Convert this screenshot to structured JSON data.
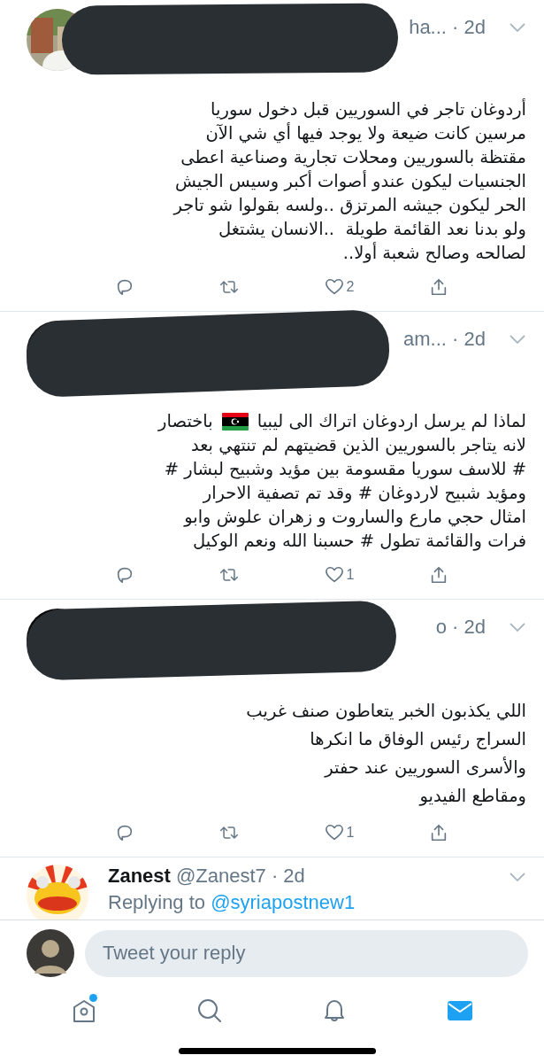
{
  "tweets": [
    {
      "handle": "ha...",
      "time": "· 2d",
      "text": "أردوغان تاجر في السوريين قبل دخول سوريا\nمرسين كانت ضيعة ولا يوجد فيها أي شي الآن\nمقتظة بالسوريين ومحلات تجارية وصناعية اعطى\nالجنسيات ليكون عندو أصوات أكبر وسيس الجيش\nالحر ليكون جيشه المرتزق ..ولسه بقولوا شو تاجر\nولو بدنا نعد القائمة طويلة  ..الانسان يشتغل\nلصالحه وصالح شعبة أولا..",
      "like_count": "2"
    },
    {
      "handle": "am...",
      "time": "· 2d",
      "lead": {
        "before": "لماذا لم يرسل اردوغان اتراك الى ليبيا",
        "after": "باختصار"
      },
      "text": "لانه يتاجر بالسوريين الذين قضيتهم لم تنتهي بعد\n# للاسف سوريا مقسومة بين مؤيد وشبيح لبشار #\nومؤيد شبيح لاردوغان # وقد تم تصفية الاحرار\nامثال حجي مارع والساروت و زهران علوش وابو\nفرات والقائمة تطول # حسبنا الله ونعم الوكيل",
      "like_count": "1"
    },
    {
      "handle": "o",
      "time": "· 2d",
      "text": "اللي يكذبون الخبر يتعاطون صنف غريب\nالسراج رئيس الوفاق ما انكرها\nوالأسرى السوريين عند حفتر\nومقاطع الفيديو",
      "like_count": "1"
    }
  ],
  "reply_preview": {
    "name": "Zanest",
    "handle": "@Zanest7",
    "time": "· 2d",
    "replying_to": "Replying to",
    "mention": "@syriapostnew1"
  },
  "composer": {
    "placeholder": "Tweet your reply"
  },
  "tabs": [
    {
      "kind": "home",
      "selected": false,
      "badge": true
    },
    {
      "kind": "search",
      "selected": false,
      "badge": false
    },
    {
      "kind": "notifications",
      "selected": false,
      "badge": false
    },
    {
      "kind": "messages",
      "selected": true,
      "badge": false
    }
  ]
}
